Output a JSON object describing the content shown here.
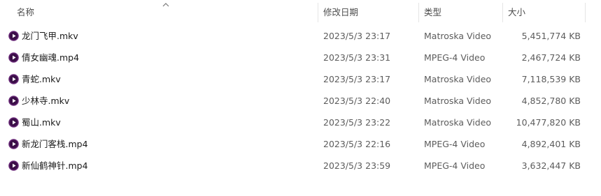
{
  "header": {
    "columns": {
      "name": "名称",
      "modified": "修改日期",
      "type": "类型",
      "size": "大小"
    },
    "sort_indicator": "sort-ascending-icon"
  },
  "files": [
    {
      "name": "龙门飞甲.mkv",
      "modified": "2023/5/3 23:17",
      "type": "Matroska Video",
      "size": "5,451,774 KB",
      "icon": "video-file-icon"
    },
    {
      "name": "倩女幽魂.mp4",
      "modified": "2023/5/3 23:31",
      "type": "MPEG-4 Video",
      "size": "2,467,724 KB",
      "icon": "video-file-icon"
    },
    {
      "name": "青蛇.mkv",
      "modified": "2023/5/3 23:17",
      "type": "Matroska Video",
      "size": "7,118,539 KB",
      "icon": "video-file-icon"
    },
    {
      "name": "少林寺.mkv",
      "modified": "2023/5/3 22:40",
      "type": "Matroska Video",
      "size": "4,852,780 KB",
      "icon": "video-file-icon"
    },
    {
      "name": "蜀山.mkv",
      "modified": "2023/5/3 23:22",
      "type": "Matroska Video",
      "size": "10,477,820 KB",
      "icon": "video-file-icon"
    },
    {
      "name": "新龙门客栈.mp4",
      "modified": "2023/5/3 22:16",
      "type": "MPEG-4 Video",
      "size": "4,892,401 KB",
      "icon": "video-file-icon"
    },
    {
      "name": "新仙鹤神针.mp4",
      "modified": "2023/5/3 23:59",
      "type": "MPEG-4 Video",
      "size": "3,632,447 KB",
      "icon": "video-file-icon"
    }
  ],
  "colors": {
    "icon_ring": "#6b2a7a",
    "icon_fill": "#3b0f48",
    "icon_play": "#ffffff",
    "header_text": "#4d4d4d",
    "cell_text": "#5c5c5c"
  }
}
